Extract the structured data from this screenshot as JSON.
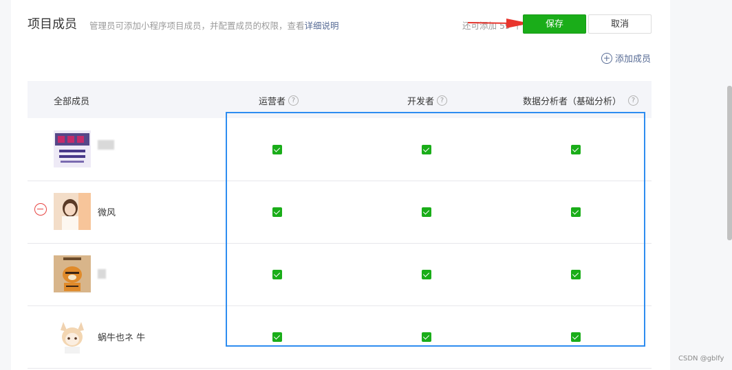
{
  "header": {
    "title": "项目成员",
    "description": "管理员可添加小程序项目成员，并配置成员的权限，查看",
    "description_link": "详细说明",
    "remaining": "还可添加 59 个",
    "save_label": "保存",
    "cancel_label": "取消",
    "add_member_label": "添加成员"
  },
  "table": {
    "columns": [
      {
        "label": "全部成员",
        "help": false
      },
      {
        "label": "运营者",
        "help": true
      },
      {
        "label": "开发者",
        "help": true
      },
      {
        "label": "数据分析者（基础分析）",
        "help": true
      }
    ],
    "help_glyph": "?",
    "rows": [
      {
        "name": "",
        "removable": false,
        "operator": true,
        "developer": true,
        "analyst": true
      },
      {
        "name": "微风",
        "removable": true,
        "operator": true,
        "developer": true,
        "analyst": true
      },
      {
        "name": "",
        "removable": false,
        "operator": true,
        "developer": true,
        "analyst": true
      },
      {
        "name": "蜗牛也ネ 牛",
        "removable": false,
        "operator": true,
        "developer": true,
        "analyst": true
      }
    ]
  },
  "colors": {
    "accent_green": "#1aad19",
    "link_blue": "#576b95",
    "selection_box": "#2d8cf0",
    "annotation_arrow": "#e8352d",
    "remove_red": "#e64340"
  },
  "watermark": "CSDN @gblfy"
}
